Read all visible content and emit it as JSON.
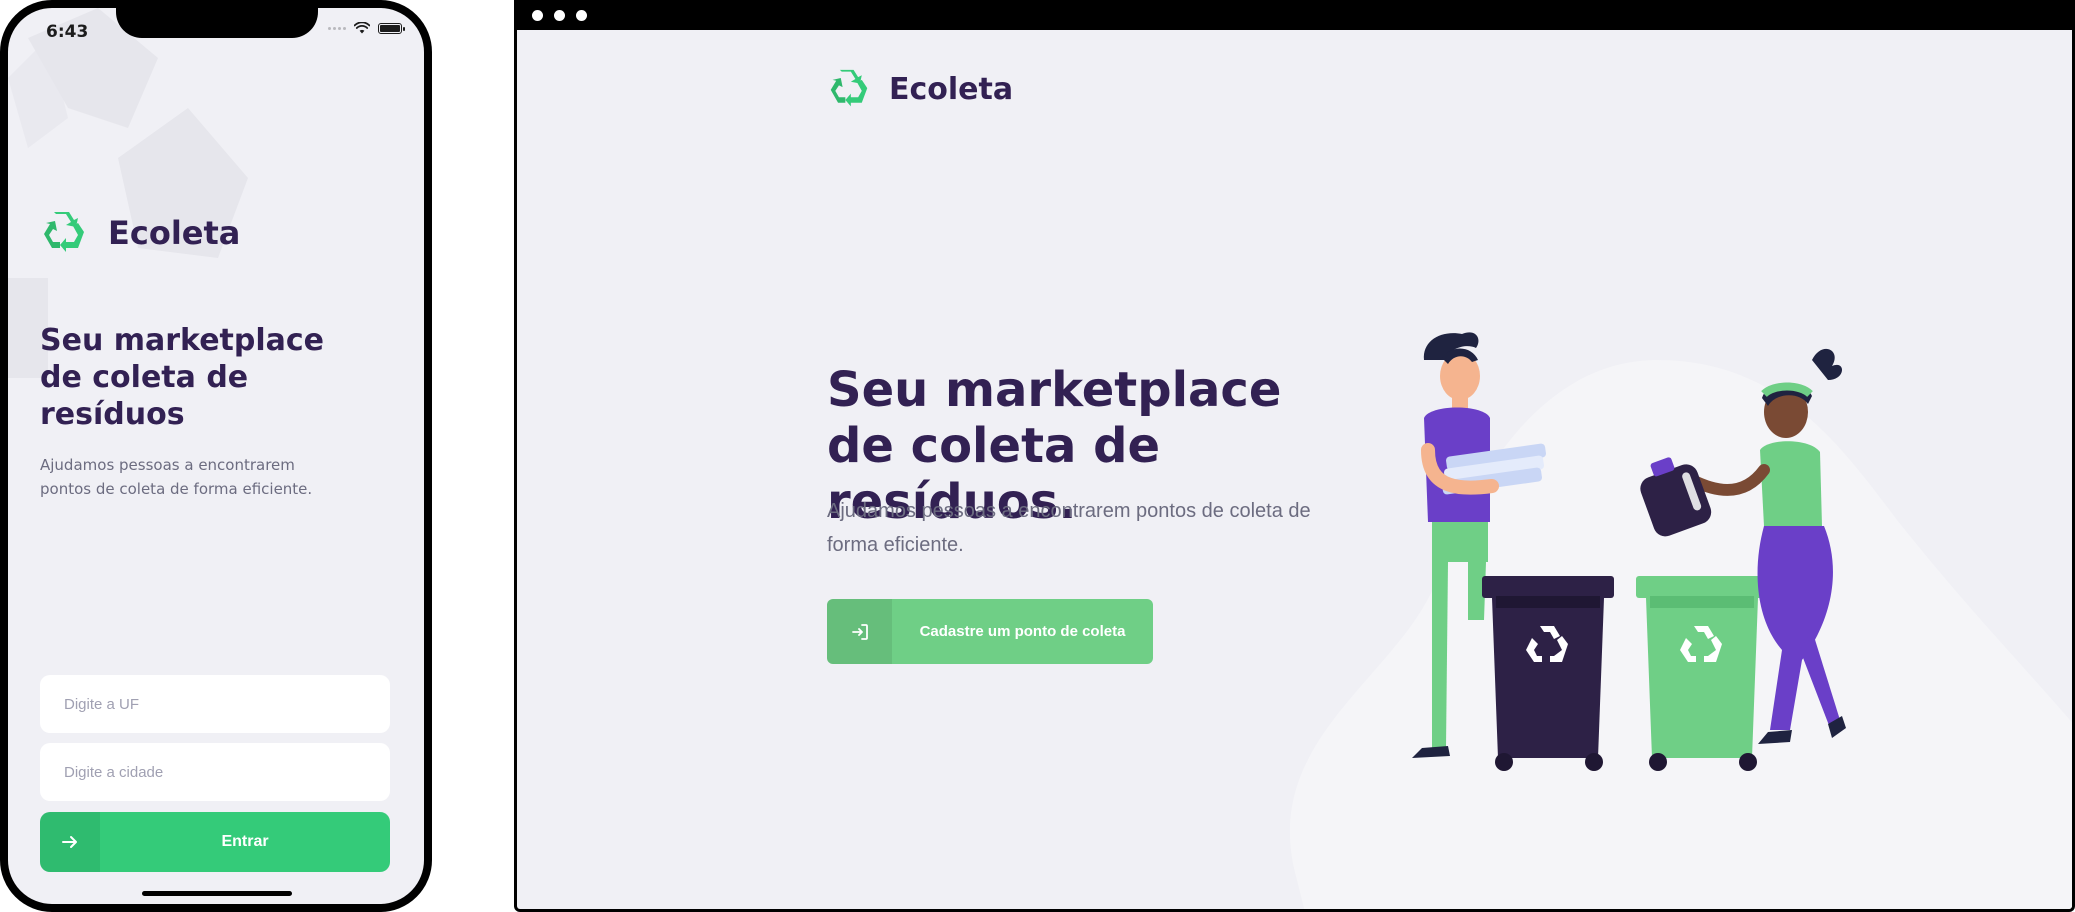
{
  "phone": {
    "status_time": "6:43",
    "brand": "Ecoleta",
    "title": "Seu marketplace de coleta de resíduos",
    "description": "Ajudamos pessoas a encontrarem pontos de coleta de forma eficiente.",
    "uf_placeholder": "Digite a UF",
    "city_placeholder": "Digite a cidade",
    "enter_button_label": "Entrar",
    "enter_button_icon": "arrow-right-icon"
  },
  "browser": {
    "brand": "Ecoleta",
    "title": "Seu marketplace de coleta de resíduos.",
    "description": "Ajudamos pessoas a encontrarem pontos de coleta de forma eficiente.",
    "register_button_label": "Cadastre um ponto de coleta",
    "register_button_icon": "log-in-icon"
  },
  "colors": {
    "primary_dark": "#322153",
    "accent_green": "#34cb79",
    "accent_green_light": "#6fcf86",
    "background": "#f0f0f5",
    "text_muted": "#6c6c80"
  }
}
